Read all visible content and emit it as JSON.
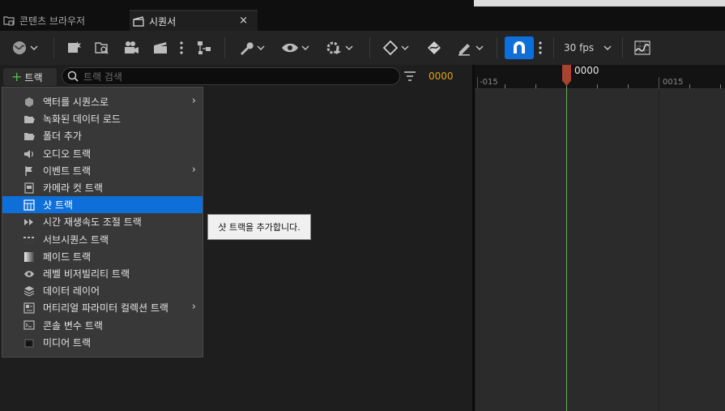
{
  "tabs": [
    {
      "label": "콘텐츠 브라우저",
      "icon": "folder-icon"
    },
    {
      "label": "시퀀서",
      "icon": "clapperboard-icon",
      "close": "×"
    }
  ],
  "toolbar": {
    "fps": "30 fps",
    "icons": [
      "world-icon",
      "save-sequence-icon",
      "find-asset-icon",
      "camera-add-icon",
      "render-movie-icon",
      "more-icon",
      "actor-options-icon",
      "wrench-icon",
      "view-options-icon",
      "playback-options-icon",
      "keyframe-icon",
      "key-interp-icon",
      "edit-pen-icon",
      "snap-magnet-icon",
      "curve-editor-icon"
    ]
  },
  "track_header": {
    "add_label": "트랙",
    "search_placeholder": "트랙 검색",
    "current_frame": "0000"
  },
  "timeline": {
    "playhead_label": "0000",
    "ruler_labels": [
      "-015",
      "0015"
    ],
    "playhead_color": "#a8432e",
    "playhead_line_color": "#5fae5f"
  },
  "menu": {
    "items": [
      {
        "label": "액터를 시퀀스로",
        "icon": "actor-icon",
        "submenu": true
      },
      {
        "label": "녹화된 데이터 로드",
        "icon": "folder-open-icon",
        "submenu": false
      },
      {
        "label": "폴더 추가",
        "icon": "folder-add-icon",
        "submenu": false
      },
      {
        "label": "오디오 트랙",
        "icon": "speaker-icon",
        "submenu": false
      },
      {
        "label": "이벤트 트랙",
        "icon": "flag-icon",
        "submenu": true
      },
      {
        "label": "카메라 컷 트랙",
        "icon": "camera-cut-icon",
        "submenu": false
      },
      {
        "label": "샷 트랙",
        "icon": "shot-icon",
        "submenu": false,
        "active": true
      },
      {
        "label": "시간 재생속도 조절 트랙",
        "icon": "time-dilation-icon",
        "submenu": false
      },
      {
        "label": "서브시퀀스 트랙",
        "icon": "subsequence-icon",
        "submenu": false
      },
      {
        "label": "페이드 트랙",
        "icon": "fade-icon",
        "submenu": false
      },
      {
        "label": "레벨 비저빌리티 트랙",
        "icon": "eye-icon",
        "submenu": false
      },
      {
        "label": "데이터 레이어",
        "icon": "layers-icon",
        "submenu": false
      },
      {
        "label": "머티리얼 파라미터 컬렉션 트랙",
        "icon": "material-icon",
        "submenu": true
      },
      {
        "label": "콘솔 변수 트랙",
        "icon": "console-icon",
        "submenu": false
      },
      {
        "label": "미디어 트랙",
        "icon": "media-icon",
        "submenu": false
      }
    ],
    "submenu_glyph": "›",
    "active_color": "#0e6fd9"
  },
  "tooltip": {
    "text": "샷 트랙을 추가합니다."
  }
}
